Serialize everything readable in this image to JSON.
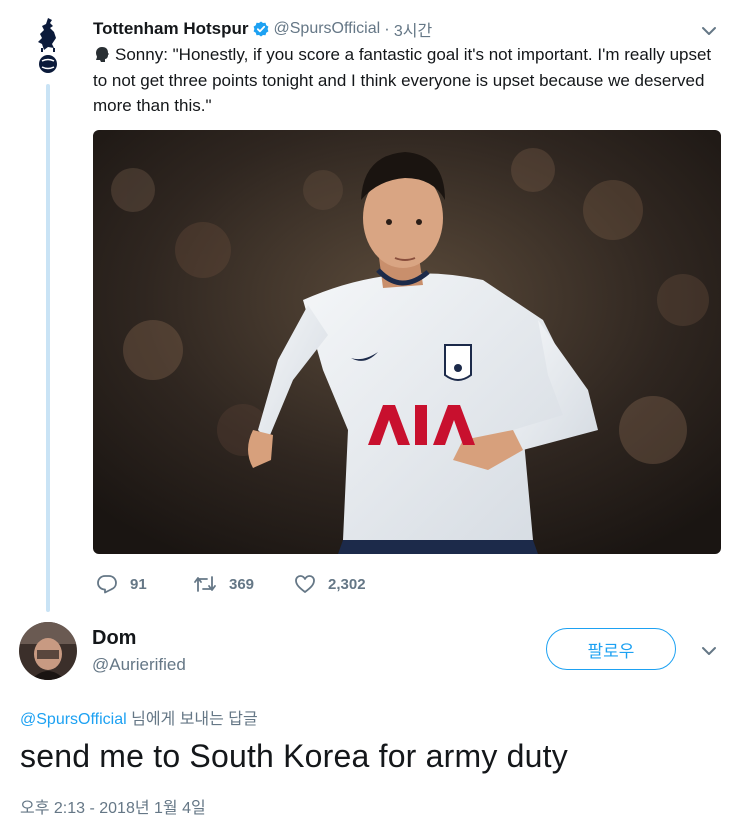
{
  "tweet": {
    "author_name": "Tottenham Hotspur",
    "handle": "@SpursOfficial",
    "separator": "·",
    "time": "3시간",
    "text": "Sonny: \"Honestly, if you score a fantastic goal it's not important. I'm really upset to not get three points tonight and I think everyone is upset because we deserved more than this.\"",
    "stats": {
      "replies": "91",
      "retweets": "369",
      "likes": "2,302"
    }
  },
  "reply": {
    "author_name": "Dom",
    "handle": "@Aurierified",
    "follow_label": "팔로우",
    "reply_to_mention": "@SpursOfficial",
    "reply_to_suffix": " 님에게 보내는 답글",
    "text": "send me to South Korea for army duty",
    "timestamp": "오후 2:13 - 2018년 1월 4일"
  },
  "colors": {
    "accent": "#1da1f2",
    "muted_text": "#657786",
    "thread_line": "#c9e3f5",
    "primary_text": "#14171a"
  },
  "icons": {
    "verified": "verified-badge-icon",
    "menu": "chevron-down-icon",
    "reply": "reply-icon",
    "retweet": "retweet-icon",
    "like": "heart-icon",
    "speaking": "speaking-head-icon"
  }
}
